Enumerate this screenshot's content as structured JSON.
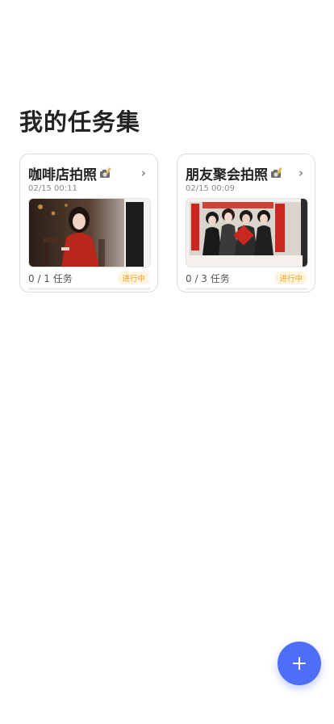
{
  "header": {
    "title": "我的任务集"
  },
  "task_sets": [
    {
      "title": "咖啡店拍照",
      "title_icon": "camera-emoji-icon",
      "date": "02/15 00:11",
      "progress_text": "0 / 1 任务",
      "progress_fraction": 0,
      "status": "进行中"
    },
    {
      "title": "朋友聚会拍照",
      "title_icon": "camera-emoji-icon",
      "date": "02/15 00:09",
      "progress_text": "0 / 3 任务",
      "progress_fraction": 0,
      "status": "进行中"
    }
  ],
  "fab": {
    "icon": "plus-icon"
  },
  "colors": {
    "accent": "#4f6ef7",
    "status_text": "#f0a020",
    "status_bg": "#fff4df"
  }
}
